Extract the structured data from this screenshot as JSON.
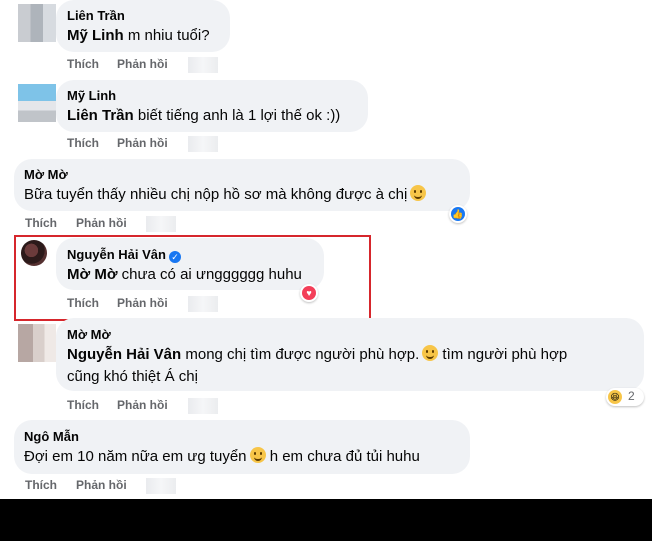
{
  "actions": {
    "like": "Thích",
    "reply": "Phản hồi"
  },
  "comments": [
    {
      "author": "Liên Trần",
      "mention": "Mỹ Linh",
      "text": " m nhiu tuổi?"
    },
    {
      "author": "Mỹ Linh",
      "mention": "Liên Trần",
      "text": " biết tiếng anh là 1 lợi thế ok :))"
    },
    {
      "author": "Mờ Mờ",
      "text": "Bữa tuyển thấy nhiều chị nộp hồ sơ mà không được à chị",
      "reaction": "like-icon"
    },
    {
      "author": "Nguyễn Hải Vân",
      "verified": true,
      "mention": "Mờ Mờ",
      "text": " chưa có ai ưngggggg huhu",
      "reaction": "heart-icon"
    },
    {
      "author": "Mờ Mờ",
      "mention": "Nguyễn Hải Vân",
      "text": " mong chị tìm được người phù hợp.",
      "text_after_emoji": " tìm người phù hợp",
      "text_line2": "cũng khó thiệt Á chị",
      "reaction": "laugh-icon",
      "reaction_count": "2"
    },
    {
      "author": "Ngô Mẫn",
      "text": "Đợi em 10 năm nữa em ưg tuyển",
      "text_after_emoji": " h em chưa đủ tủi huhu"
    }
  ],
  "colors": {
    "highlight": "#d6262c",
    "bubble": "#f0f2f5",
    "secondary_text": "#65676b",
    "like": "#1877f2",
    "heart": "#f33e58"
  }
}
